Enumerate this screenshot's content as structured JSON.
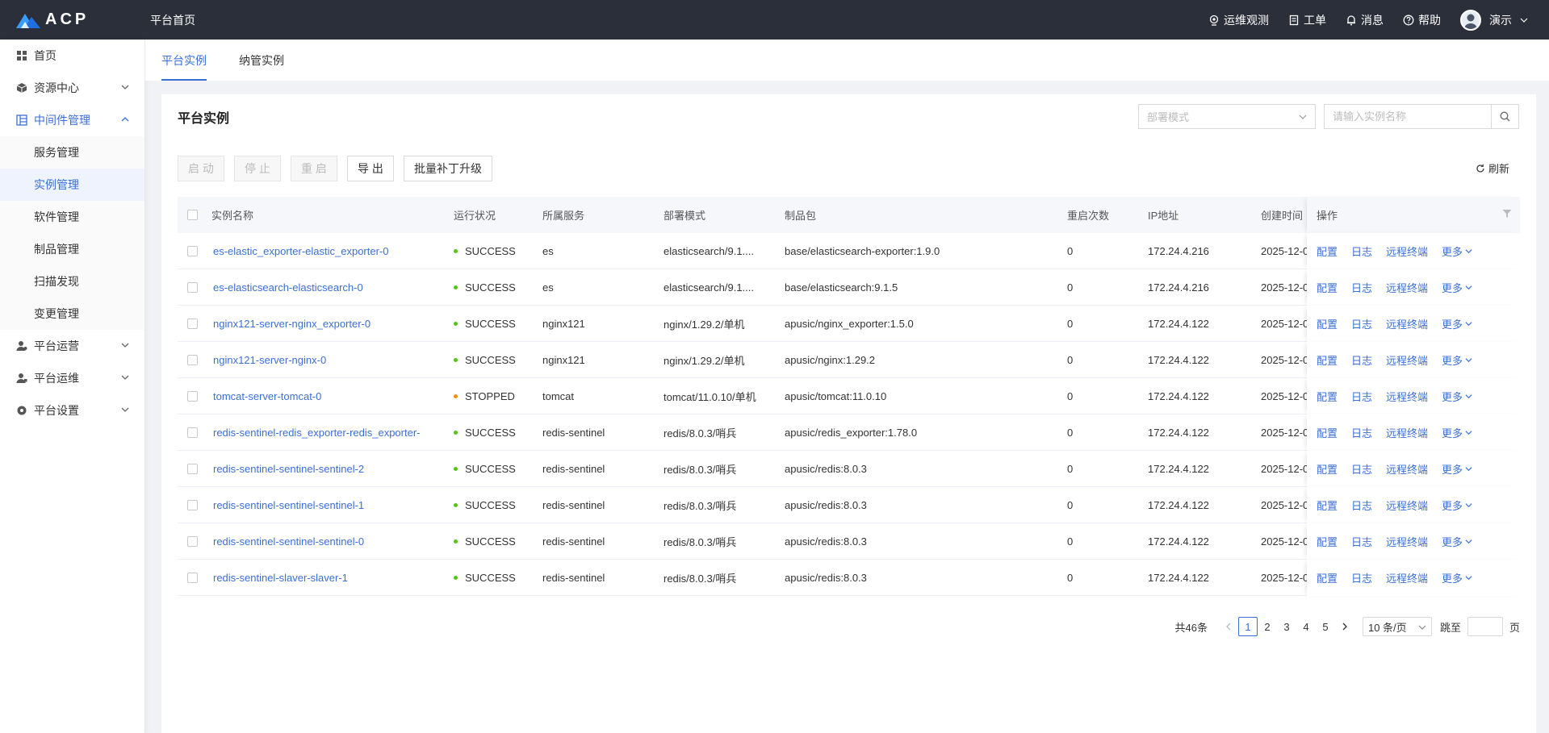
{
  "topbar": {
    "logo_text": "ACP",
    "home_label": "平台首页",
    "items": [
      {
        "label": "运维观测",
        "icon": "observe-icon"
      },
      {
        "label": "工单",
        "icon": "ticket-icon"
      },
      {
        "label": "消息",
        "icon": "bell-icon"
      },
      {
        "label": "帮助",
        "icon": "help-icon"
      }
    ],
    "user_name": "演示"
  },
  "sidebar": {
    "items": [
      {
        "label": "首页",
        "icon": "dashboard-icon"
      },
      {
        "label": "资源中心",
        "icon": "cube-icon"
      },
      {
        "label": "中间件管理",
        "icon": "middleware-icon"
      },
      {
        "label": "平台运营",
        "icon": "user-ops-icon"
      },
      {
        "label": "平台运维",
        "icon": "user-maint-icon"
      },
      {
        "label": "平台设置",
        "icon": "gear-icon"
      }
    ],
    "sub_items": [
      "服务管理",
      "实例管理",
      "软件管理",
      "制品管理",
      "扫描发现",
      "变更管理"
    ]
  },
  "tabs": [
    "平台实例",
    "纳管实例"
  ],
  "card": {
    "title": "平台实例",
    "deploy_placeholder": "部署模式",
    "search_placeholder": "请输入实例名称",
    "buttons": {
      "start": "启 动",
      "stop": "停 止",
      "restart": "重 启",
      "export": "导 出",
      "patch": "批量补丁升级"
    },
    "refresh": "刷新"
  },
  "table": {
    "columns": {
      "name": "实例名称",
      "status": "运行状况",
      "service": "所属服务",
      "mode": "部署模式",
      "artifact": "制品包",
      "restarts": "重启次数",
      "ip": "IP地址",
      "created": "创建时间",
      "ops": "操作"
    },
    "ops_labels": {
      "config": "配置",
      "log": "日志",
      "terminal": "远程终端",
      "more": "更多"
    },
    "rows": [
      {
        "name": "es-elastic_exporter-elastic_exporter-0",
        "status": "SUCCESS",
        "service": "es",
        "mode": "elasticsearch/9.1....",
        "artifact": "base/elasticsearch-exporter:1.9.0",
        "restarts": "0",
        "ip": "172.24.4.216",
        "created": "2025-12-0"
      },
      {
        "name": "es-elasticsearch-elasticsearch-0",
        "status": "SUCCESS",
        "service": "es",
        "mode": "elasticsearch/9.1....",
        "artifact": "base/elasticsearch:9.1.5",
        "restarts": "0",
        "ip": "172.24.4.216",
        "created": "2025-12-0"
      },
      {
        "name": "nginx121-server-nginx_exporter-0",
        "status": "SUCCESS",
        "service": "nginx121",
        "mode": "nginx/1.29.2/单机",
        "artifact": "apusic/nginx_exporter:1.5.0",
        "restarts": "0",
        "ip": "172.24.4.122",
        "created": "2025-12-0"
      },
      {
        "name": "nginx121-server-nginx-0",
        "status": "SUCCESS",
        "service": "nginx121",
        "mode": "nginx/1.29.2/单机",
        "artifact": "apusic/nginx:1.29.2",
        "restarts": "0",
        "ip": "172.24.4.122",
        "created": "2025-12-0"
      },
      {
        "name": "tomcat-server-tomcat-0",
        "status": "STOPPED",
        "service": "tomcat",
        "mode": "tomcat/11.0.10/单机",
        "artifact": "apusic/tomcat:11.0.10",
        "restarts": "0",
        "ip": "172.24.4.122",
        "created": "2025-12-0"
      },
      {
        "name": "redis-sentinel-redis_exporter-redis_exporter-",
        "status": "SUCCESS",
        "service": "redis-sentinel",
        "mode": "redis/8.0.3/哨兵",
        "artifact": "apusic/redis_exporter:1.78.0",
        "restarts": "0",
        "ip": "172.24.4.122",
        "created": "2025-12-0"
      },
      {
        "name": "redis-sentinel-sentinel-sentinel-2",
        "status": "SUCCESS",
        "service": "redis-sentinel",
        "mode": "redis/8.0.3/哨兵",
        "artifact": "apusic/redis:8.0.3",
        "restarts": "0",
        "ip": "172.24.4.122",
        "created": "2025-12-0"
      },
      {
        "name": "redis-sentinel-sentinel-sentinel-1",
        "status": "SUCCESS",
        "service": "redis-sentinel",
        "mode": "redis/8.0.3/哨兵",
        "artifact": "apusic/redis:8.0.3",
        "restarts": "0",
        "ip": "172.24.4.122",
        "created": "2025-12-0"
      },
      {
        "name": "redis-sentinel-sentinel-sentinel-0",
        "status": "SUCCESS",
        "service": "redis-sentinel",
        "mode": "redis/8.0.3/哨兵",
        "artifact": "apusic/redis:8.0.3",
        "restarts": "0",
        "ip": "172.24.4.122",
        "created": "2025-12-0"
      },
      {
        "name": "redis-sentinel-slaver-slaver-1",
        "status": "SUCCESS",
        "service": "redis-sentinel",
        "mode": "redis/8.0.3/哨兵",
        "artifact": "apusic/redis:8.0.3",
        "restarts": "0",
        "ip": "172.24.4.122",
        "created": "2025-12-0"
      }
    ]
  },
  "pagination": {
    "total": "共46条",
    "pages": [
      "1",
      "2",
      "3",
      "4",
      "5"
    ],
    "page_size": "10 条/页",
    "jump_label": "跳至",
    "page_unit": "页"
  },
  "colors": {
    "accent": "#3b6fd6",
    "success": "#52c41a",
    "stopped": "#fa8c16",
    "topbar": "#2b2f3a"
  }
}
